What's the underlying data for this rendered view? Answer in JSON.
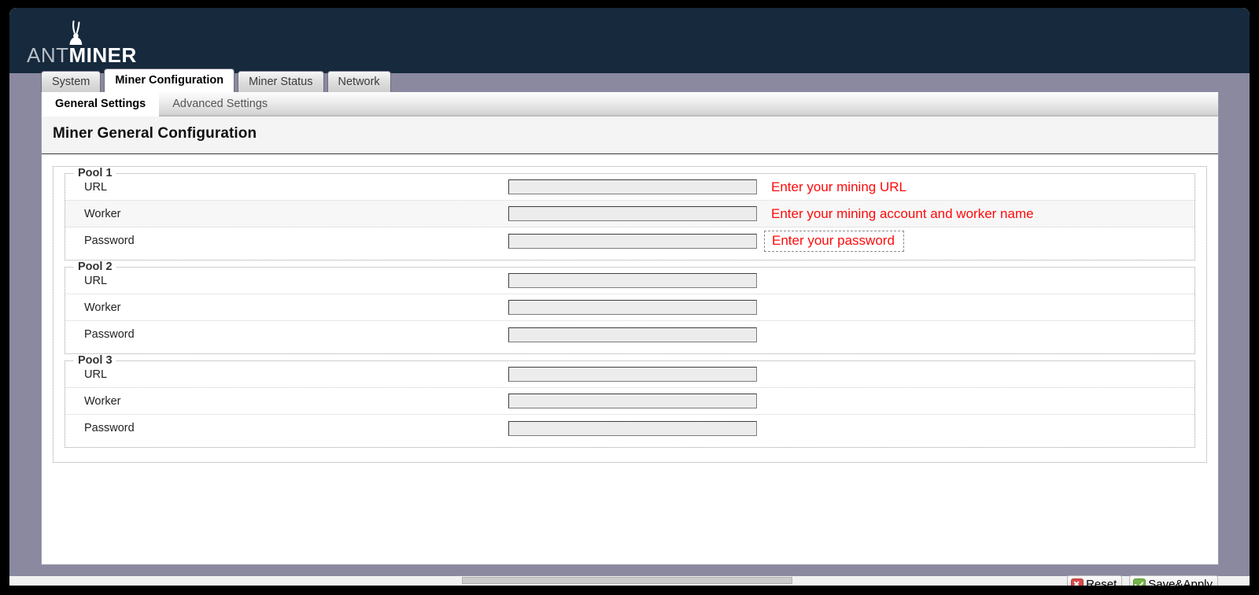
{
  "window": {
    "logo": {
      "part1": "ANT",
      "part2": "MINER",
      "icon": "ant-icon"
    }
  },
  "tabs": [
    {
      "label": "System",
      "active": false
    },
    {
      "label": "Miner Configuration",
      "active": true
    },
    {
      "label": "Miner Status",
      "active": false
    },
    {
      "label": "Network",
      "active": false
    }
  ],
  "subtabs": [
    {
      "label": "General Settings",
      "active": true
    },
    {
      "label": "Advanced Settings",
      "active": false
    }
  ],
  "page": {
    "title": "Miner General Configuration"
  },
  "pools": [
    {
      "legend": "Pool 1",
      "rows": [
        {
          "label": "URL",
          "value": "",
          "placeholder": "",
          "hint": "Enter your mining URL",
          "hint_selected": false
        },
        {
          "label": "Worker",
          "value": "",
          "placeholder": "",
          "hint": "Enter your mining account and worker name",
          "hint_selected": false
        },
        {
          "label": "Password",
          "value": "",
          "placeholder": "",
          "hint": "Enter your password",
          "hint_selected": true
        }
      ]
    },
    {
      "legend": "Pool 2",
      "rows": [
        {
          "label": "URL",
          "value": "",
          "placeholder": "",
          "hint": "",
          "hint_selected": false
        },
        {
          "label": "Worker",
          "value": "",
          "placeholder": "",
          "hint": "",
          "hint_selected": false
        },
        {
          "label": "Password",
          "value": "",
          "placeholder": "",
          "hint": "",
          "hint_selected": false
        }
      ]
    },
    {
      "legend": "Pool 3",
      "rows": [
        {
          "label": "URL",
          "value": "",
          "placeholder": "",
          "hint": "",
          "hint_selected": false
        },
        {
          "label": "Worker",
          "value": "",
          "placeholder": "",
          "hint": "",
          "hint_selected": false
        },
        {
          "label": "Password",
          "value": "",
          "placeholder": "",
          "hint": "",
          "hint_selected": false
        }
      ]
    }
  ],
  "footer": {
    "reset_label": "Reset",
    "save_label": "Save&Apply",
    "reset_icon": "red-x-icon",
    "save_icon": "green-check-icon"
  },
  "colors": {
    "banner": "#16293d",
    "page_background": "#8a89a0",
    "hint_red": "#ff0a0a",
    "reset_icon": "#d94a4a",
    "save_icon": "#74b44a"
  }
}
